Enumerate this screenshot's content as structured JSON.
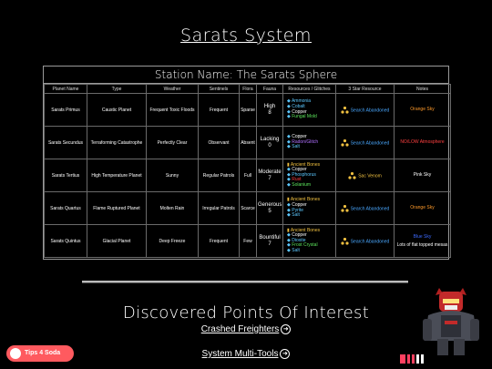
{
  "page": {
    "title": "Sarats System"
  },
  "table": {
    "station": "Station Name: The Sarats Sphere",
    "headers": [
      "Planet Name",
      "Type",
      "Weather",
      "Sentinels",
      "Flora",
      "Fauna",
      "Resources / Glitches",
      "3 Star Resource",
      "Notes"
    ],
    "rows": [
      {
        "name": "Sarats Primus",
        "type": "Caustic Planet",
        "weather": "Frequent Toxic Floods",
        "sentinels": "Frequent",
        "flora": "Sparse",
        "fauna": [
          "High",
          "8"
        ],
        "resources": [
          {
            "text": "Ammonia",
            "color": "cy"
          },
          {
            "text": "Cobalt",
            "color": "cy"
          },
          {
            "text": "Copper",
            "color": "wh"
          },
          {
            "text": "Fungal Mold",
            "color": "gr"
          }
        ],
        "star": "Search Abandoned",
        "star_color": "abandoned",
        "notes": [
          "Orange Sky"
        ],
        "notes_color": "or"
      },
      {
        "name": "Sarats Secundus",
        "type": "Terraforming Catastrophe",
        "weather": "Perfectly Clear",
        "sentinels": "Observant",
        "flora": "Absent",
        "fauna": [
          "Lacking",
          "0"
        ],
        "resources": [
          {
            "text": "Copper",
            "color": "wh"
          },
          {
            "text": "Radon/Glitch",
            "color": "pu"
          },
          {
            "text": "Salt",
            "color": "cy"
          }
        ],
        "star": "Search Abandoned",
        "star_color": "abandoned",
        "notes": [
          "NO/LOW Atmosphere"
        ],
        "notes_color": "rd"
      },
      {
        "name": "Sarats Tertius",
        "type": "High Temperature Planet",
        "weather": "Sunny",
        "sentinels": "Regular Patrols",
        "flora": "Full",
        "fauna": [
          "Moderate",
          "7"
        ],
        "resources": [
          {
            "text": "Ancient Bones",
            "color": "ye"
          },
          {
            "text": "Copper",
            "color": "wh"
          },
          {
            "text": "Phosphorus",
            "color": "cy"
          },
          {
            "text": "Rust",
            "color": "rd"
          },
          {
            "text": "Solanium",
            "color": "gr"
          }
        ],
        "star": "Sac Venom",
        "star_color": "ye",
        "notes": [
          "Pink Sky"
        ],
        "notes_color": "wh"
      },
      {
        "name": "Sarats Quartus",
        "type": "Flame Ruptured Planet",
        "weather": "Molten Rain",
        "sentinels": "Irregular Patrols",
        "flora": "Scarce",
        "fauna": [
          "Generous",
          "5"
        ],
        "resources": [
          {
            "text": "Ancient Bones",
            "color": "ye"
          },
          {
            "text": "Copper",
            "color": "wh"
          },
          {
            "text": "Pyrite",
            "color": "cy"
          },
          {
            "text": "Salt",
            "color": "cy"
          }
        ],
        "star": "Search Abandoned",
        "star_color": "abandoned",
        "notes": [
          "Orange Sky"
        ],
        "notes_color": "or"
      },
      {
        "name": "Sarats Quintus",
        "type": "Glacial Planet",
        "weather": "Deep Freeze",
        "sentinels": "Frequent",
        "flora": "Few",
        "fauna": [
          "Bountiful",
          "7"
        ],
        "resources": [
          {
            "text": "Ancient Bones",
            "color": "ye"
          },
          {
            "text": "Copper",
            "color": "wh"
          },
          {
            "text": "Dioxite",
            "color": "cy"
          },
          {
            "text": "Frost Crystal",
            "color": "gr"
          },
          {
            "text": "Salt",
            "color": "cy"
          }
        ],
        "star": "Search Abandoned",
        "star_color": "abandoned",
        "notes": [
          "Blue Sky",
          "Lots of flat topped mesas"
        ],
        "notes_color": "bl"
      }
    ]
  },
  "poi": {
    "heading": "Discovered Points Of Interest",
    "links": [
      "Crashed Freighters",
      "System Multi-Tools"
    ]
  },
  "tip": {
    "label": "Tips 4 Soda"
  },
  "colors": {
    "accent_star": "#f0c040",
    "abandoned": "#4aa8ff",
    "tip_bg": "#ff5a5f"
  },
  "icons": [
    "three-star-icon",
    "resource-diamond-icon",
    "bone-icon",
    "arrow-circle-icon",
    "cup-icon",
    "robot-avatar",
    "site-logo"
  ]
}
